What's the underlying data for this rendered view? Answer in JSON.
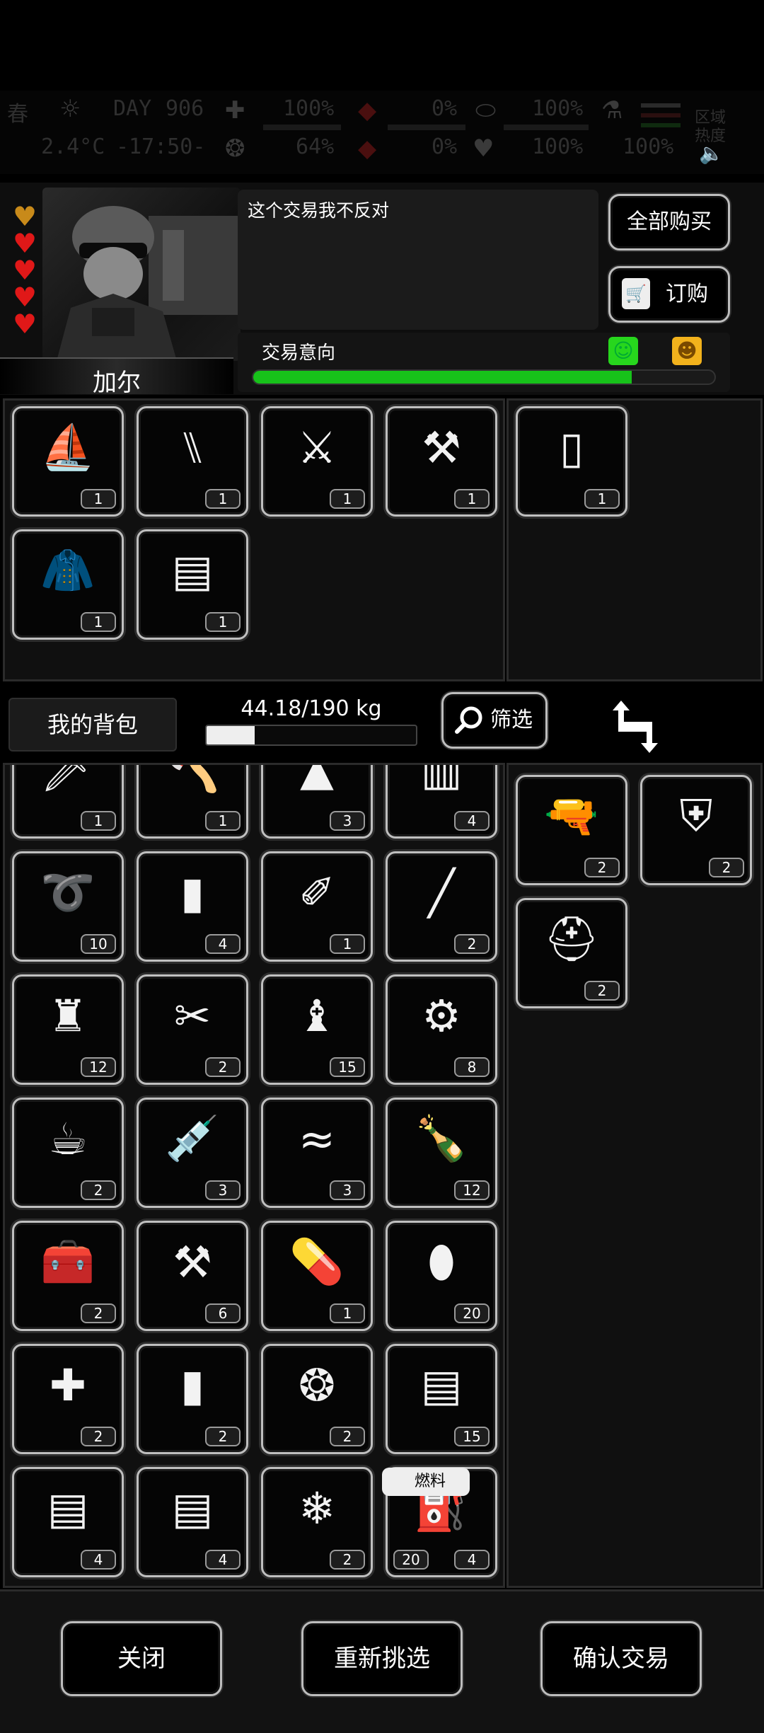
{
  "status": {
    "season": "春",
    "day_label": "DAY",
    "day": "906",
    "temperature": "2.4°C",
    "clock": "-17:50-",
    "stats": [
      "100%",
      "0%",
      "100%",
      "100%",
      "64%",
      "0%",
      "100%",
      "100%"
    ],
    "region_label_1": "区域",
    "region_label_2": "热度"
  },
  "npc": {
    "name": "加尔",
    "hearts": 5,
    "dialog": "这个交易我不反对"
  },
  "buttons": {
    "buy_all": "全部购买",
    "order": "订购",
    "order_cart_text": "WBHD"
  },
  "intent": {
    "label": "交易意向",
    "value_fraction": 0.82,
    "color": "#17c21a"
  },
  "trader_items": [
    {
      "icon": "iron-icon",
      "glyph": "⛵",
      "qty": "1"
    },
    {
      "icon": "folding-chair-icon",
      "glyph": "⑊",
      "qty": "1"
    },
    {
      "icon": "claw-blade-icon",
      "glyph": "⚔",
      "qty": "1"
    },
    {
      "icon": "wrapped-handle-icon",
      "glyph": "⚒",
      "qty": "1"
    },
    {
      "icon": "jacket-icon",
      "glyph": "🧥",
      "qty": "1"
    },
    {
      "icon": "supply-crate-icon",
      "glyph": "▤",
      "qty": "1"
    }
  ],
  "trader_offer": [
    {
      "icon": "paper-scrap-icon",
      "glyph": "▯",
      "qty": "1"
    }
  ],
  "midbar": {
    "my_bag": "我的背包",
    "weight": "44.18/190 kg",
    "weight_fraction": 0.23,
    "filter": "筛选"
  },
  "my_items": [
    {
      "icon": "machete-icon",
      "glyph": "🗡",
      "qty": "1",
      "corner": true
    },
    {
      "icon": "axe-icon",
      "glyph": "🪓",
      "qty": "1",
      "corner": true
    },
    {
      "icon": "torn-cloth-icon",
      "glyph": "▲",
      "qty": "3"
    },
    {
      "icon": "towel-icon",
      "glyph": "▥",
      "qty": "4"
    },
    {
      "icon": "rope-icon",
      "glyph": "➰",
      "qty": "10"
    },
    {
      "icon": "water-bottle-icon",
      "glyph": "▮",
      "qty": "4"
    },
    {
      "icon": "tweezers-icon",
      "glyph": "✐",
      "qty": "1"
    },
    {
      "icon": "cigarette-icon",
      "glyph": "╱",
      "qty": "2"
    },
    {
      "icon": "spray-cans-icon",
      "glyph": "♜",
      "qty": "12"
    },
    {
      "icon": "bandage-icon",
      "glyph": "✂",
      "qty": "2"
    },
    {
      "icon": "tool-bag-icon",
      "glyph": "♝",
      "qty": "15"
    },
    {
      "icon": "repair-kit-icon",
      "glyph": "⚙",
      "qty": "8"
    },
    {
      "icon": "coffee-cup-icon",
      "glyph": "☕",
      "qty": "2"
    },
    {
      "icon": "syringe-icon",
      "glyph": "💉",
      "qty": "3"
    },
    {
      "icon": "cloth-roll-icon",
      "glyph": "≈",
      "qty": "3"
    },
    {
      "icon": "liquor-bottle-icon",
      "glyph": "🍾",
      "qty": "12"
    },
    {
      "icon": "toolbox-icon",
      "glyph": "🧰",
      "qty": "2"
    },
    {
      "icon": "tool-crate-icon",
      "glyph": "⚒",
      "qty": "6"
    },
    {
      "icon": "pills-icon",
      "glyph": "💊",
      "qty": "1"
    },
    {
      "icon": "pill-bottle-icon",
      "glyph": "⬮",
      "qty": "20"
    },
    {
      "icon": "adrenaline-syringe-icon",
      "glyph": "✚",
      "qty": "2"
    },
    {
      "icon": "sauce-bottle-icon",
      "glyph": "▮",
      "qty": "2"
    },
    {
      "icon": "food-tray-icon",
      "glyph": "❂",
      "qty": "2"
    },
    {
      "icon": "supply-crate-icon",
      "glyph": "▤",
      "qty": "15"
    },
    {
      "icon": "supply-crate-icon",
      "glyph": "▤",
      "qty": "4"
    },
    {
      "icon": "supply-crate-icon",
      "glyph": "▤",
      "qty": "4"
    },
    {
      "icon": "ice-drink-icon",
      "glyph": "❄",
      "qty": "2"
    },
    {
      "icon": "fuel-canister-icon",
      "glyph": "⛽",
      "qty": "4",
      "qty_left": "20",
      "tag": "燃料"
    }
  ],
  "my_offer": [
    {
      "icon": "orange-rifle-icon",
      "glyph": "🔫",
      "qty": "2",
      "color": "#f08a1a"
    },
    {
      "icon": "backpack-frame-icon",
      "glyph": "⛨",
      "qty": "2"
    },
    {
      "icon": "helmet-icon",
      "glyph": "⛑",
      "qty": "2"
    }
  ],
  "bottom": {
    "close": "关闭",
    "reselect": "重新挑选",
    "confirm": "确认交易"
  }
}
